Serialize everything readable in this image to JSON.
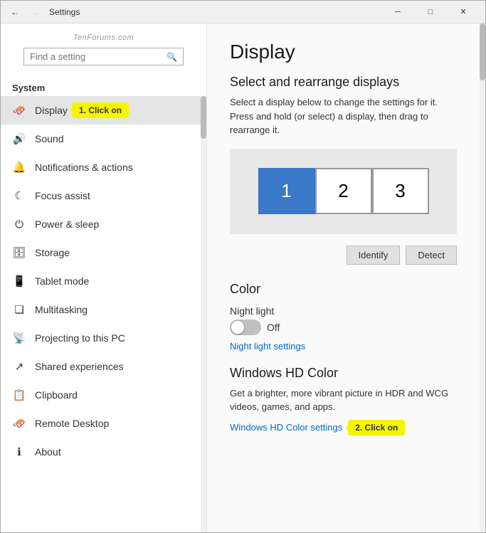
{
  "window": {
    "title": "Settings",
    "controls": {
      "minimize": "─",
      "maximize": "□",
      "close": "✕"
    }
  },
  "sidebar": {
    "search_placeholder": "Find a setting",
    "section_label": "System",
    "watermark": "TenForums.com",
    "items": [
      {
        "id": "display",
        "label": "Display",
        "icon": "🖥",
        "active": true
      },
      {
        "id": "sound",
        "label": "Sound",
        "icon": "🔊",
        "active": false
      },
      {
        "id": "notifications",
        "label": "Notifications & actions",
        "icon": "🔔",
        "active": false
      },
      {
        "id": "focus",
        "label": "Focus assist",
        "icon": "🌙",
        "active": false
      },
      {
        "id": "power",
        "label": "Power & sleep",
        "icon": "⏻",
        "active": false
      },
      {
        "id": "storage",
        "label": "Storage",
        "icon": "🗄",
        "active": false
      },
      {
        "id": "tablet",
        "label": "Tablet mode",
        "icon": "📱",
        "active": false
      },
      {
        "id": "multitasking",
        "label": "Multitasking",
        "icon": "⊞",
        "active": false
      },
      {
        "id": "projecting",
        "label": "Projecting to this PC",
        "icon": "📡",
        "active": false
      },
      {
        "id": "shared",
        "label": "Shared experiences",
        "icon": "↗",
        "active": false
      },
      {
        "id": "clipboard",
        "label": "Clipboard",
        "icon": "📋",
        "active": false
      },
      {
        "id": "remote",
        "label": "Remote Desktop",
        "icon": "🖥",
        "active": false
      },
      {
        "id": "about",
        "label": "About",
        "icon": "ℹ",
        "active": false
      }
    ]
  },
  "main": {
    "title": "Display",
    "select_section": {
      "heading": "Select and rearrange displays",
      "description": "Select a display below to change the settings for it. Press and hold (or select) a display, then drag to rearrange it."
    },
    "monitors": [
      {
        "number": "1",
        "selected": true
      },
      {
        "number": "2",
        "selected": false
      },
      {
        "number": "3",
        "selected": false
      }
    ],
    "buttons": {
      "identify": "Identify",
      "detect": "Detect"
    },
    "color_section": {
      "heading": "Color",
      "night_light_label": "Night light",
      "toggle_status": "Off",
      "settings_link": "Night light settings"
    },
    "hd_color": {
      "heading": "Windows HD Color",
      "description": "Get a brighter, more vibrant picture in HDR and WCG videos, games, and apps.",
      "settings_link": "Windows HD Color settings"
    },
    "tooltips": {
      "click_on_1": "1. Click on",
      "click_on_2": "2. Click on"
    }
  }
}
